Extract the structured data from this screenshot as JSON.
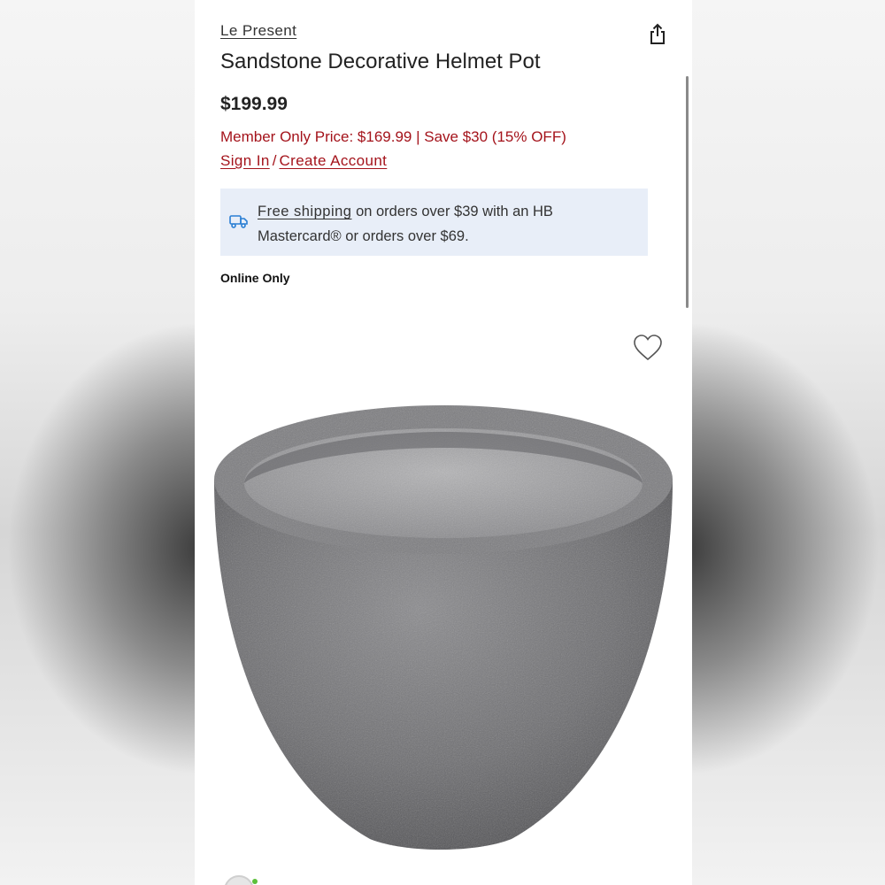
{
  "brand": "Le Present",
  "title": "Sandstone Decorative Helmet Pot",
  "price": "$199.99",
  "member_price": "Member Only Price: $169.99 | Save $30 (15% OFF)",
  "auth": {
    "sign_in": "Sign In",
    "separator": "/",
    "create_account": "Create Account"
  },
  "shipping": {
    "link": "Free shipping",
    "text": " on orders over $39 with an HB Mastercard® or orders over $69."
  },
  "availability": "Online Only",
  "icons": {
    "share": "share-icon",
    "truck": "truck-icon",
    "heart": "heart-icon"
  },
  "colors": {
    "member_red": "#a4131b",
    "shipping_bg": "#e8eef8",
    "pot_gray": "#6e6e70"
  }
}
